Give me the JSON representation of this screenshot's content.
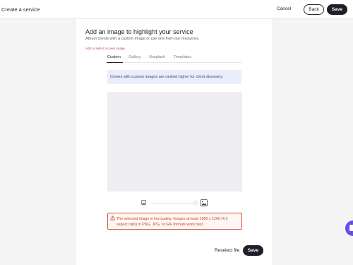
{
  "header": {
    "title": "Create a service",
    "cancel_label": "Cancel",
    "back_label": "Back",
    "save_label": "Save"
  },
  "section": {
    "heading": "Add an image to highlight your service",
    "subheading": "Attract clients with a custom image or use one from our resources.",
    "error_hint": "Add or select a cover image."
  },
  "tabs": [
    {
      "label": "Custom",
      "active": true
    },
    {
      "label": "Gallery",
      "active": false
    },
    {
      "label": "Unsplash",
      "active": false
    },
    {
      "label": "Templates",
      "active": false
    }
  ],
  "info_banner": "Covers with custom images are ranked higher for client discovery.",
  "zoom": {
    "min_icon": "image-small-icon",
    "max_icon": "image-large-icon",
    "level": 1.0
  },
  "warning": {
    "icon": "warning-triangle-icon",
    "text": "The selected image is low quality. Images at least 1600 x 1200 (4:3 aspect ratio) in PNG, JPG, or GIF formats work best."
  },
  "footer": {
    "reselect_label": "Reselect file",
    "save_label": "Save"
  },
  "colors": {
    "primary_button": "#1d1f2b",
    "error": "#c43b52",
    "warning_border": "#d9573f",
    "info_bg": "#eaeefa",
    "chat_bubble": "#6a4de8"
  }
}
